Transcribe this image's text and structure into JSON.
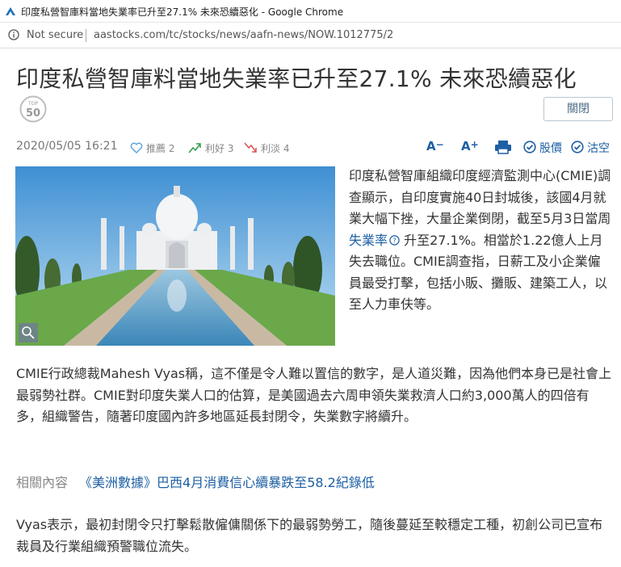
{
  "browser": {
    "window_title": "印度私營智庫料當地失業率已升至27.1% 未來恐續惡化 - Google Chrome",
    "security_label": "Not secure",
    "url": "aastocks.com/tc/stocks/news/aafn-news/NOW.1012775/2"
  },
  "article": {
    "headline": "印度私營智庫料當地失業率已升至27.1% 未來恐續惡化",
    "badge_top": "TOP",
    "badge_num": "50",
    "close_label": "關閉",
    "datetime": "2020/05/05 16:21",
    "recommend_label": "推薦 2",
    "bullish_label": "利好 3",
    "bearish_label": "利淡 4",
    "font_minus": "A",
    "font_plus": "A",
    "quote_label": "股價",
    "hide_label": "沽空",
    "lead_before_link": "印度私營智庫組織印度經濟監測中心(CMIE)調查顯示，自印度實施40日封城後，該國4月就業大幅下挫，大量企業倒閉，截至5月3日當周 ",
    "lead_link": "失業率",
    "lead_after_link": " 升至27.1%。相當於1.22億人上月失去職位。CMIE調查指，日薪工及小企業僱員最受打擊，包括小販、攤販、建築工人，以至人力車伕等。",
    "para1": "CMIE行政總裁Mahesh Vyas稱，這不僅是令人難以置信的數字，是人道災難，因為他們本身已是社會上最弱勢社群。CMIE對印度失業人口的估算，是美國過去六周申領失業救濟人口約3,000萬人的四倍有多，組織警告，隨著印度國內許多地區延長封閉令，失業數字將續升。",
    "related_label": "相關內容",
    "related_link": "《美洲數據》巴西4月消費信心續暴跌至58.2紀錄低",
    "para2": "Vyas表示，最初封閉令只打擊鬆散僱傭關係下的最弱勢勞工，隨後蔓延至較穩定工種，初創公司已宣布裁員及行業組織預警職位流失。"
  },
  "colors": {
    "accent": "#1d5fa3",
    "bullish": "#2e9b4a",
    "bearish": "#d9534f"
  }
}
